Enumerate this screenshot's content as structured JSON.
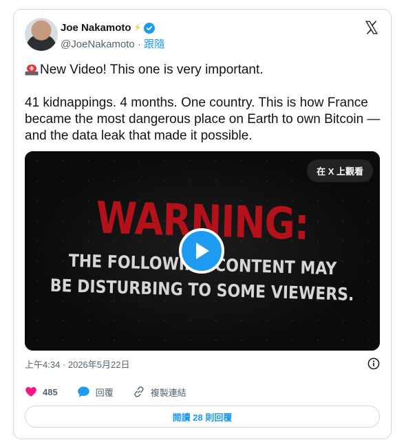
{
  "author": {
    "name": "Joe Nakamoto",
    "handle": "@JoeNakamoto",
    "separator": "·",
    "follow_label": "跟隨"
  },
  "post": {
    "line1": "New Video! This one is very important.",
    "line2": "41 kidnappings. 4 months. One country. This is how France became the most dangerous place on Earth to own Bitcoin — and the data leak that made it possible."
  },
  "media": {
    "view_on_x_label": "在 X 上觀看",
    "headline": "WARNING:",
    "subtext_line1": "THE FOLLOWING CONTENT MAY",
    "subtext_line2": "BE DISTURBING TO SOME VIEWERS."
  },
  "meta": {
    "timestamp": "上午4:34 · 2026年5月22日"
  },
  "actions": {
    "like_count": "485",
    "reply_label": "回覆",
    "copy_link_label": "複製連結"
  },
  "footer": {
    "read_replies_label": "閱讀 28 則回覆"
  },
  "colors": {
    "accent": "#1d9bf0",
    "like": "#f91880",
    "warning_red": "#b3121b",
    "muted": "#536471"
  },
  "icons": [
    "avatar",
    "bolt-emoji",
    "verified-badge-icon",
    "x-logo-icon",
    "siren-emoji",
    "play-icon",
    "info-icon",
    "heart-icon",
    "reply-bubble-icon",
    "link-icon"
  ]
}
